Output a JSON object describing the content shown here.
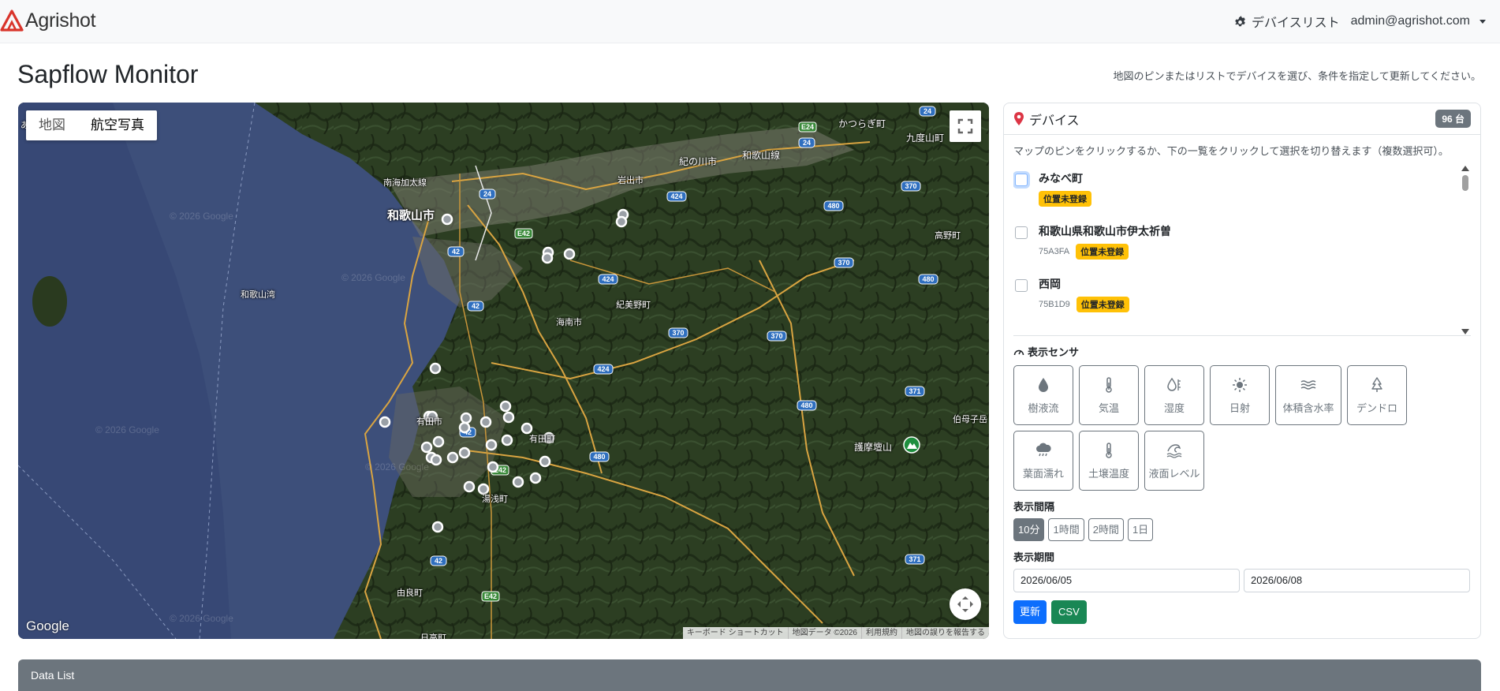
{
  "navbar": {
    "brand": "Agrishot",
    "device_list": "デバイスリスト",
    "user": "admin@agrishot.com"
  },
  "header": {
    "title": "Sapflow Monitor",
    "hint": "地図のピンまたはリストでデバイスを選び、条件を指定して更新してください。"
  },
  "map": {
    "type_map": "地図",
    "type_satellite": "航空写真",
    "google": "Google",
    "attribution": [
      "キーボード ショートカット",
      "地図データ ©2026",
      "利用規約",
      "地図の誤りを報告する"
    ],
    "watermark": "© 2026 Google",
    "places": {
      "wakayama_city": "和歌山市",
      "iwade": "岩出市",
      "kinokawa": "紀の川市",
      "katsuragi": "かつらぎ町",
      "kudoyama": "九度山町",
      "koya": "高野町",
      "kimino": "紀美野町",
      "kainan": "海南市",
      "arida": "有田市",
      "arida_cho": "有田町",
      "yuasa": "湯浅町",
      "yura": "由良町",
      "hidaka": "日高町",
      "gomadan": "護摩壇山",
      "ibo": "伯母子岳",
      "wakayama_bay": "和歌山湾",
      "nankai": "南海加太線",
      "wakayama_line": "和歌山線",
      "ae": "あ"
    },
    "routes": [
      "24",
      "42",
      "424",
      "370",
      "480",
      "371",
      "E42",
      "E24"
    ],
    "colors": {
      "sea": "#3d4f7a",
      "land": "#2b3d22",
      "road": "#d9a441",
      "pin": "#ffffff"
    }
  },
  "devices": {
    "title": "デバイス",
    "count": "96 台",
    "hint": "マップのピンをクリックするか、下の一覧をクリックして選択を切り替えます（複数選択可）。",
    "items": [
      {
        "name": "みなべ町",
        "id": "",
        "status": "位置未登録"
      },
      {
        "name": "和歌山県和歌山市伊太祈曽",
        "id": "75A3FA",
        "status": "位置未登録"
      },
      {
        "name": "西岡",
        "id": "75B1D9",
        "status": "位置未登録"
      }
    ]
  },
  "sensors": {
    "title": "表示センサ",
    "items": [
      {
        "label": "樹液流",
        "icon": "droplet-icon"
      },
      {
        "label": "気温",
        "icon": "thermometer-icon"
      },
      {
        "label": "湿度",
        "icon": "humidity-icon"
      },
      {
        "label": "日射",
        "icon": "sun-icon"
      },
      {
        "label": "体積含水率",
        "icon": "water-wave-icon"
      },
      {
        "label": "デンドロ",
        "icon": "tree-icon"
      },
      {
        "label": "葉面濡れ",
        "icon": "cloud-rain-icon"
      },
      {
        "label": "土壌温度",
        "icon": "thermometer-icon"
      },
      {
        "label": "液面レベル",
        "icon": "tsunami-icon"
      }
    ]
  },
  "interval": {
    "title": "表示間隔",
    "options": [
      "10分",
      "1時間",
      "2時間",
      "1日"
    ],
    "selected": "10分"
  },
  "period": {
    "title": "表示期間",
    "start": "2026/06/05",
    "end": "2026/06/08"
  },
  "actions": {
    "update": "更新",
    "csv": "CSV"
  },
  "datalist": {
    "title": "Data List"
  }
}
